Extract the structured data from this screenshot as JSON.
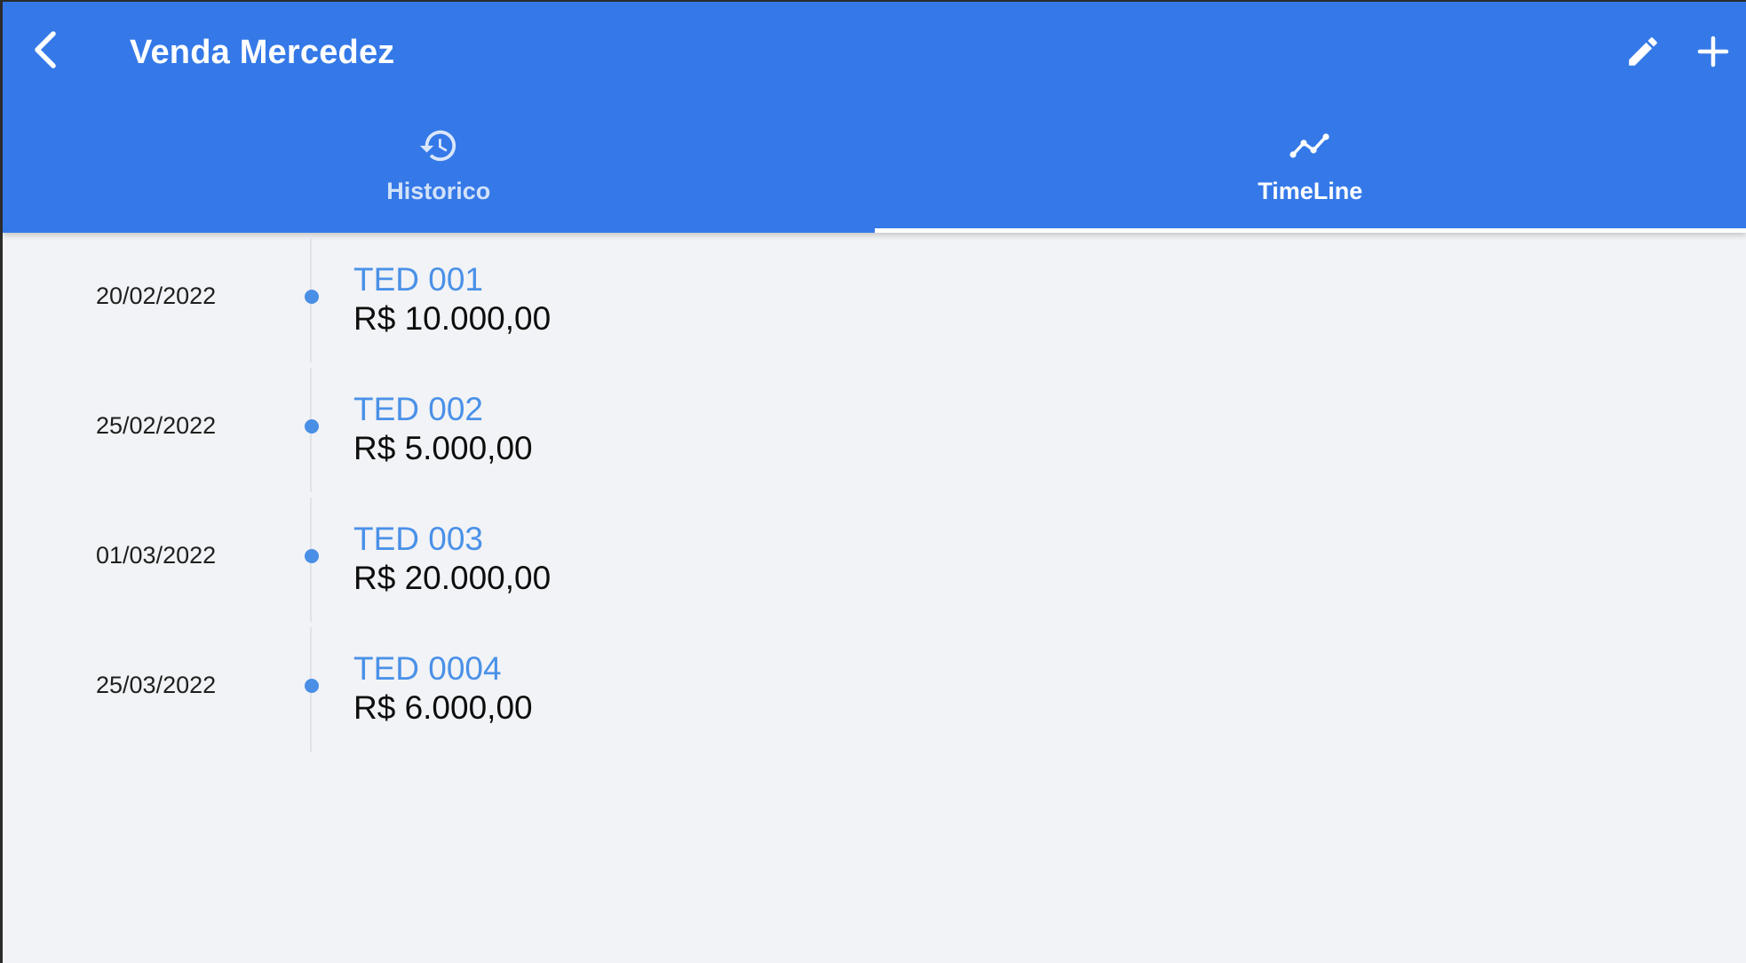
{
  "header": {
    "title": "Venda Mercedez",
    "back_icon": "chevron-left-icon",
    "edit_icon": "pencil-icon",
    "add_icon": "plus-icon",
    "bg_color": "#3579e8"
  },
  "tabs": [
    {
      "label": "Historico",
      "icon": "history-icon",
      "active": false
    },
    {
      "label": "TimeLine",
      "icon": "timeline-icon",
      "active": true
    }
  ],
  "timeline": {
    "accent_color": "#4a91e8",
    "items": [
      {
        "date": "20/02/2022",
        "title": "TED 001",
        "value": "R$ 10.000,00"
      },
      {
        "date": "25/02/2022",
        "title": "TED 002",
        "value": "R$ 5.000,00"
      },
      {
        "date": "01/03/2022",
        "title": "TED 003",
        "value": "R$ 20.000,00"
      },
      {
        "date": "25/03/2022",
        "title": "TED 0004",
        "value": "R$ 6.000,00"
      }
    ]
  }
}
